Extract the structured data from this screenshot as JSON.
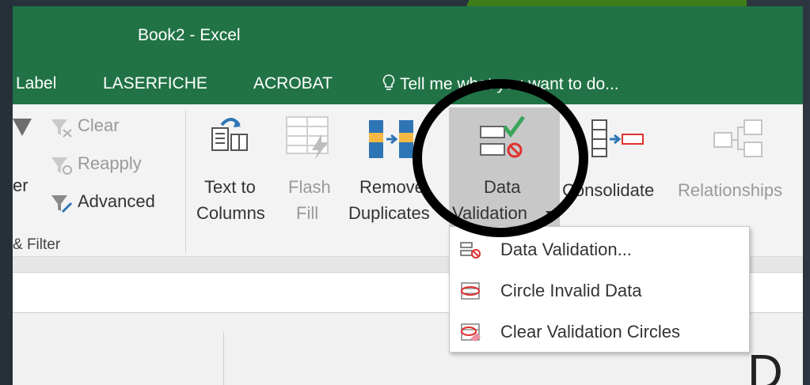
{
  "window": {
    "title": "Book2 - Excel"
  },
  "tabs": [
    "Label",
    "LASERFICHE",
    "ACROBAT"
  ],
  "tell_me": "Tell me what you want to do...",
  "sort_filter": {
    "clear": "Clear",
    "reapply": "Reapply",
    "advanced": "Advanced",
    "partial_filter": "er",
    "group_label": "& Filter"
  },
  "ribbon": {
    "text_to_columns": [
      "Text to",
      "Columns"
    ],
    "flash_fill": [
      "Flash",
      "Fill"
    ],
    "remove_duplicates": [
      "Remove",
      "Duplicates"
    ],
    "data_validation": [
      "Data",
      "Validation"
    ],
    "consolidate": "Consolidate",
    "relationships": "Relationships"
  },
  "menu": {
    "items": [
      "Data Validation...",
      "Circle Invalid Data",
      "Clear Validation Circles"
    ]
  },
  "sheet": {
    "column_header": "D"
  },
  "colors": {
    "excel_green": "#217346",
    "highlight": "#c8c8c8",
    "annotation_ring": "#000000"
  }
}
